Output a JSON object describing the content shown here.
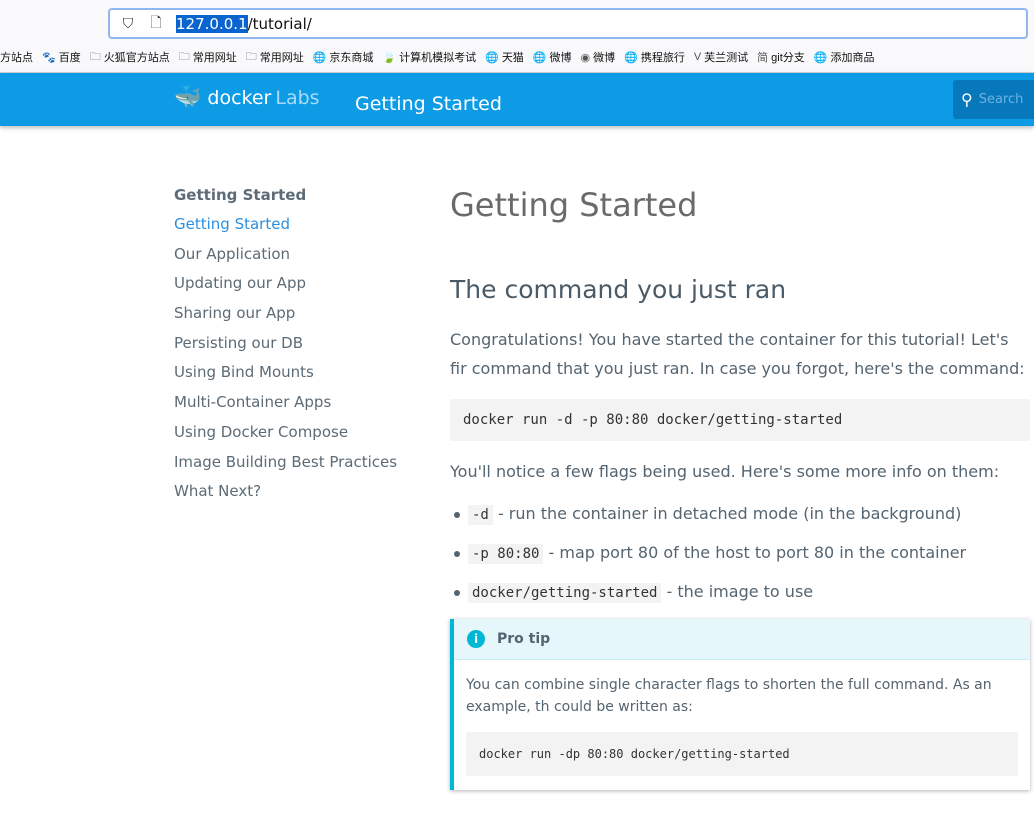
{
  "browser": {
    "url_highlight": "127.0.0.1",
    "url_rest": "/tutorial/",
    "bookmarks": [
      {
        "icon": "",
        "label": "方站点"
      },
      {
        "icon": "🐾",
        "label": "百度"
      },
      {
        "icon": "🗀",
        "label": "火狐官方站点"
      },
      {
        "icon": "🗀",
        "label": "常用网址"
      },
      {
        "icon": "🗀",
        "label": "常用网址"
      },
      {
        "icon": "🌐",
        "label": "京东商城"
      },
      {
        "icon": "🍃",
        "label": "计算机模拟考试"
      },
      {
        "icon": "🌐",
        "label": "天猫"
      },
      {
        "icon": "🌐",
        "label": "微博"
      },
      {
        "icon": "◉",
        "label": "微博"
      },
      {
        "icon": "🌐",
        "label": "携程旅行"
      },
      {
        "icon": "V",
        "label": "芙兰测试"
      },
      {
        "icon": "简",
        "label": "git分支"
      },
      {
        "icon": "🌐",
        "label": "添加商品"
      }
    ]
  },
  "header": {
    "logo_main": "docker",
    "logo_sub": "Labs",
    "title": "Getting Started",
    "search_placeholder": "Search"
  },
  "sidebar": {
    "heading": "Getting Started",
    "items": [
      "Getting Started",
      "Our Application",
      "Updating our App",
      "Sharing our App",
      "Persisting our DB",
      "Using Bind Mounts",
      "Multi-Container Apps",
      "Using Docker Compose",
      "Image Building Best Practices",
      "What Next?"
    ]
  },
  "main": {
    "title": "Getting Started",
    "subtitle": "The command you just ran",
    "intro_line1": "Congratulations! You have started the container for this tutorial! Let's fir",
    "intro_line2": "command that you just ran. In case you forgot, here's the command:",
    "command": "docker run -d -p 80:80 docker/getting-started",
    "flags_intro": "You'll notice a few flags being used. Here's some more info on them:",
    "flags": [
      {
        "code": "-d",
        "text": " - run the container in detached mode (in the background)"
      },
      {
        "code": "-p 80:80",
        "text": " - map port 80 of the host to port 80 in the container"
      },
      {
        "code": "docker/getting-started",
        "text": " - the image to use"
      }
    ],
    "tip": {
      "title": "Pro tip",
      "line1": "You can combine single character flags to shorten the full command. As an example, th",
      "line2": "could be written as:",
      "command": "docker run -dp 80:80 docker/getting-started"
    }
  }
}
